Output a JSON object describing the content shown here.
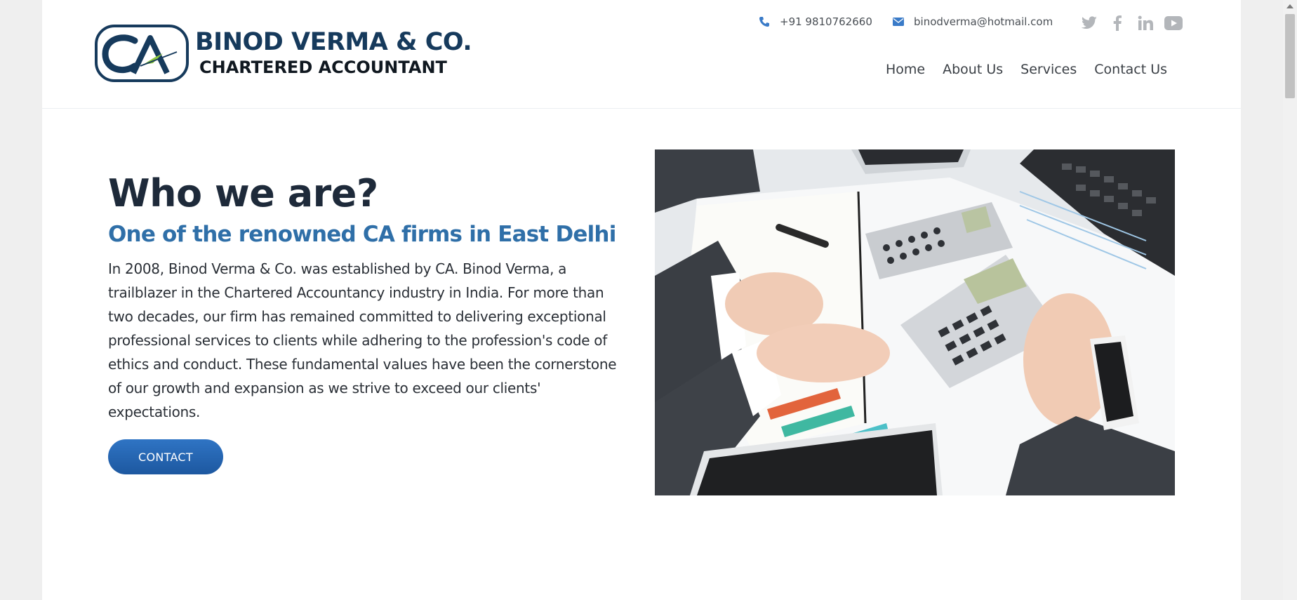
{
  "brand": {
    "logo_mark": "CA",
    "name": "BINOD VERMA & CO.",
    "tagline": "CHARTERED ACCOUNTANT",
    "colors": {
      "navy": "#163a5c",
      "accent_green": "#8cc63f",
      "link_blue": "#2f6fa8"
    }
  },
  "contact_bar": {
    "phone": "+91 9810762660",
    "email": "binodverma@hotmail.com",
    "phone_icon": "phone-icon",
    "email_icon": "envelope-icon"
  },
  "social": [
    "twitter-icon",
    "facebook-icon",
    "linkedin-icon",
    "youtube-icon"
  ],
  "nav": {
    "items": [
      {
        "label": "Home"
      },
      {
        "label": "About Us"
      },
      {
        "label": "Services"
      },
      {
        "label": "Contact Us"
      }
    ]
  },
  "hero": {
    "title": "Who we are?",
    "subtitle": "One of the renowned CA firms in East Delhi",
    "body": "In 2008, Binod Verma & Co. was established by CA. Binod Verma, a trailblazer in the Chartered Accountancy industry in India. For more than two decades, our firm has remained committed to delivering exceptional professional services to clients while adhering to the profession's code of ethics and conduct. These fundamental values have been the cornerstone of our growth and expansion as we strive to exceed our clients' expectations.",
    "button_label": "CONTACT",
    "image": "accountants-working-with-calculator-photo"
  }
}
